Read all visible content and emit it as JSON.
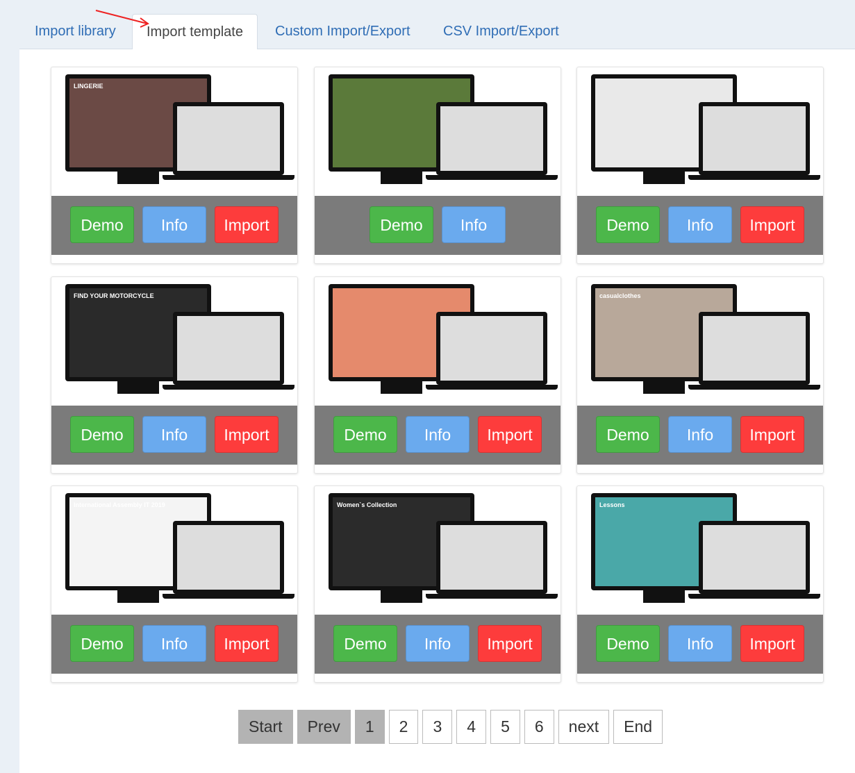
{
  "tabs": [
    {
      "label": "Import library"
    },
    {
      "label": "Import template",
      "active": true
    },
    {
      "label": "Custom Import/Export"
    },
    {
      "label": "CSV Import/Export"
    }
  ],
  "templates": [
    {
      "screen_text": "LINGERIE",
      "color": "#6b4a45",
      "buttons": {
        "demo": "Demo",
        "info": "Info",
        "import": "Import"
      }
    },
    {
      "screen_text": "",
      "color": "#5b7a3a",
      "buttons": {
        "demo": "Demo",
        "info": "Info"
      }
    },
    {
      "screen_text": "",
      "color": "#e9e9e9",
      "buttons": {
        "demo": "Demo",
        "info": "Info",
        "import": "Import"
      }
    },
    {
      "screen_text": "FIND YOUR MOTORCYCLE",
      "color": "#2a2a2a",
      "buttons": {
        "demo": "Demo",
        "info": "Info",
        "import": "Import"
      }
    },
    {
      "screen_text": "",
      "color": "#e58a6c",
      "buttons": {
        "demo": "Demo",
        "info": "Info",
        "import": "Import"
      }
    },
    {
      "screen_text": "casualclothes",
      "color": "#b8a89a",
      "buttons": {
        "demo": "Demo",
        "info": "Info",
        "import": "Import"
      }
    },
    {
      "screen_text": "International Assembly IT 2019",
      "color": "#f4f4f4",
      "buttons": {
        "demo": "Demo",
        "info": "Info",
        "import": "Import"
      }
    },
    {
      "screen_text": "Women`s Collection",
      "color": "#2b2b2b",
      "buttons": {
        "demo": "Demo",
        "info": "Info",
        "import": "Import"
      }
    },
    {
      "screen_text": "Lessons",
      "color": "#4aa8a8",
      "buttons": {
        "demo": "Demo",
        "info": "Info",
        "import": "Import"
      }
    }
  ],
  "pagination": {
    "start": "Start",
    "prev": "Prev",
    "pages": [
      "1",
      "2",
      "3",
      "4",
      "5",
      "6"
    ],
    "current": "1",
    "next": "next",
    "end": "End"
  },
  "colors": {
    "demo": "#4cb74a",
    "info": "#6aaaee",
    "import": "#fd3c3c",
    "tab_link": "#2f6db5"
  }
}
